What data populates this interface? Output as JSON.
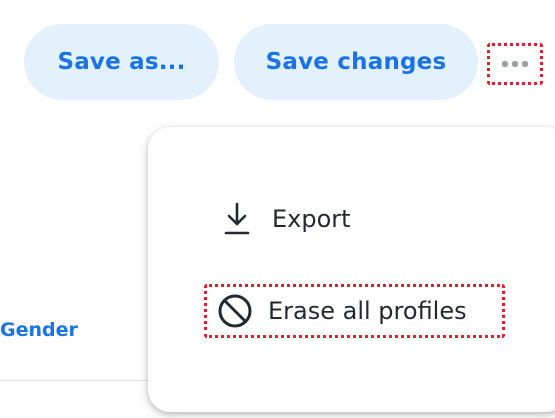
{
  "toolbar": {
    "save_as_label": "Save as...",
    "save_changes_label": "Save changes",
    "more_icon": "more-horizontal-icon"
  },
  "table": {
    "visible_header": "Gender"
  },
  "menu": {
    "items": [
      {
        "label": "Export",
        "icon": "download-icon"
      },
      {
        "label": "Erase all profiles",
        "icon": "block-icon"
      }
    ]
  },
  "colors": {
    "accent": "#1a73e8",
    "pill_bg": "#e3f1fd",
    "highlight": "#e0202a",
    "text": "#24292f"
  }
}
